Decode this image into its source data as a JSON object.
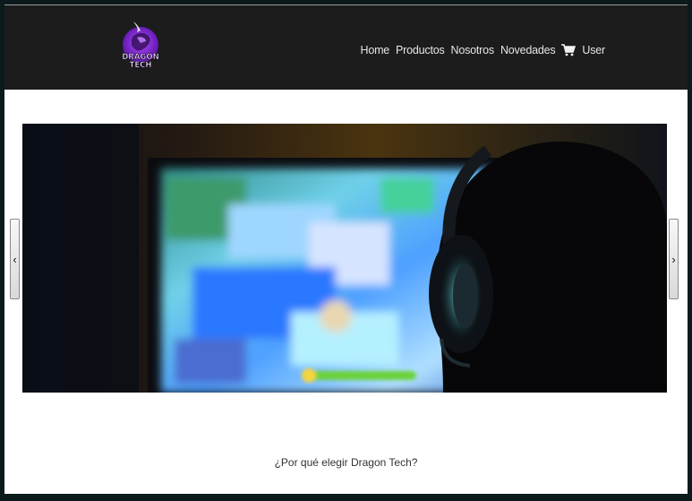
{
  "brand": {
    "logo_text_line1": "DRAGON",
    "logo_text_line2": "TECH",
    "accent": "#8a2be2"
  },
  "nav": {
    "items": [
      {
        "label": "Home"
      },
      {
        "label": "Productos"
      },
      {
        "label": "Nosotros"
      },
      {
        "label": "Novedades"
      }
    ],
    "cart_icon": "shopping-cart-icon",
    "user_label": "User"
  },
  "carousel": {
    "prev_label": "‹",
    "next_label": "›",
    "slide_description_icon": "gamer-headset-photo"
  },
  "section": {
    "title": "¿Por qué elegir Dragon Tech?"
  }
}
